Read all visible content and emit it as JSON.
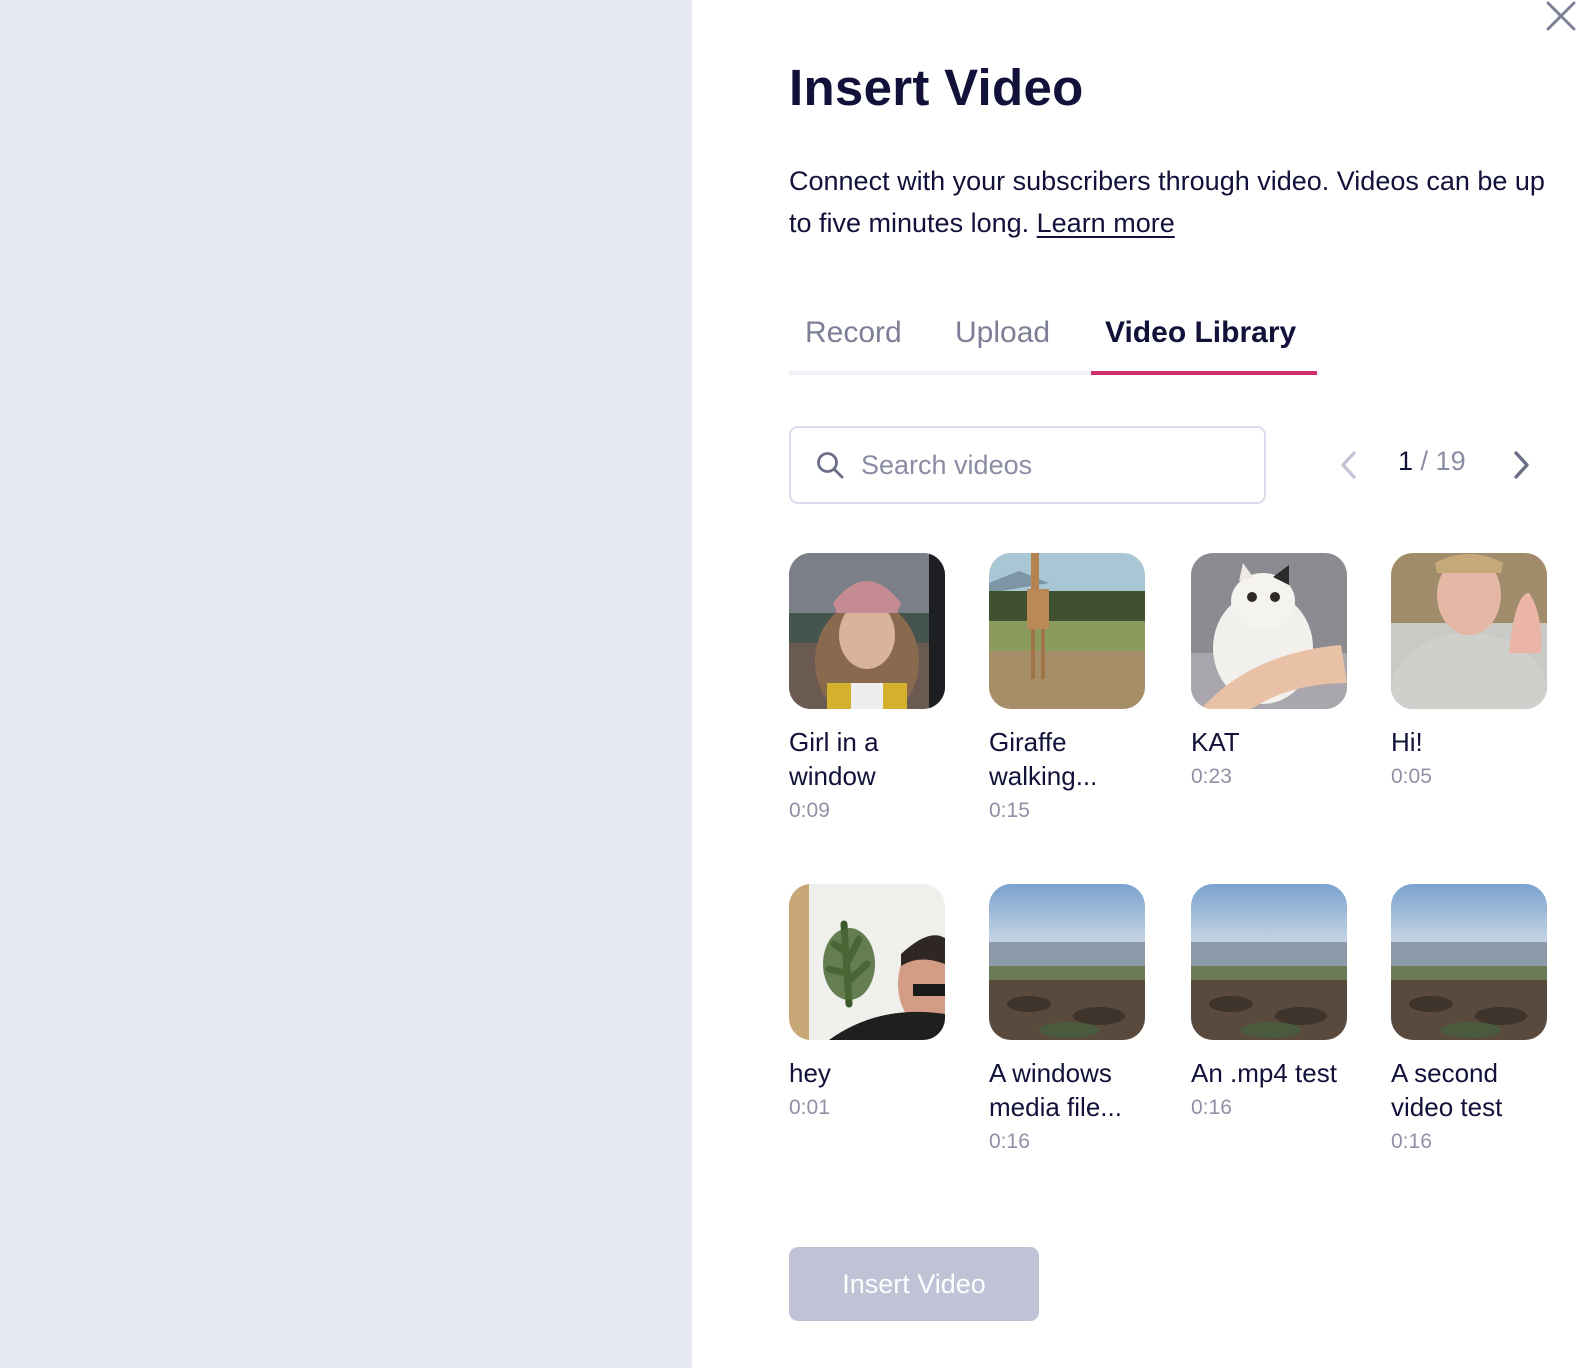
{
  "modal": {
    "title": "Insert Video",
    "description": "Connect with your subscribers through video. Videos can be up to five minutes long.",
    "learn_more": "Learn more",
    "close_icon": "close-icon"
  },
  "tabs": [
    {
      "label": "Record",
      "active": false
    },
    {
      "label": "Upload",
      "active": false
    },
    {
      "label": "Video Library",
      "active": true
    }
  ],
  "colors": {
    "accent": "#d0306b",
    "text": "#11113a",
    "muted": "#8f91a6",
    "backdrop": "#e6e9f3",
    "button_disabled": "#c0c3d6"
  },
  "search": {
    "placeholder": "Search videos",
    "value": "",
    "icon": "search-icon"
  },
  "pagination": {
    "current": "1",
    "separator": " / ",
    "total": "19",
    "prev_icon": "chevron-left-icon",
    "next_icon": "chevron-right-icon"
  },
  "videos": [
    {
      "title": "Girl in a window",
      "duration": "0:09",
      "thumb": "woman-in-pink-beanie"
    },
    {
      "title": "Giraffe walking...",
      "duration": "0:15",
      "thumb": "giraffe-savanna"
    },
    {
      "title": "KAT",
      "duration": "0:23",
      "thumb": "white-cat"
    },
    {
      "title": "Hi!",
      "duration": "0:05",
      "thumb": "woman-waving"
    },
    {
      "title": "hey",
      "duration": "0:01",
      "thumb": "man-with-plant"
    },
    {
      "title": "A windows media file...",
      "duration": "0:16",
      "thumb": "rocky-beach"
    },
    {
      "title": "An .mp4 test",
      "duration": "0:16",
      "thumb": "rocky-beach"
    },
    {
      "title": "A second video test",
      "duration": "0:16",
      "thumb": "rocky-beach"
    }
  ],
  "footer": {
    "insert_button": "Insert Video",
    "insert_enabled": false
  }
}
